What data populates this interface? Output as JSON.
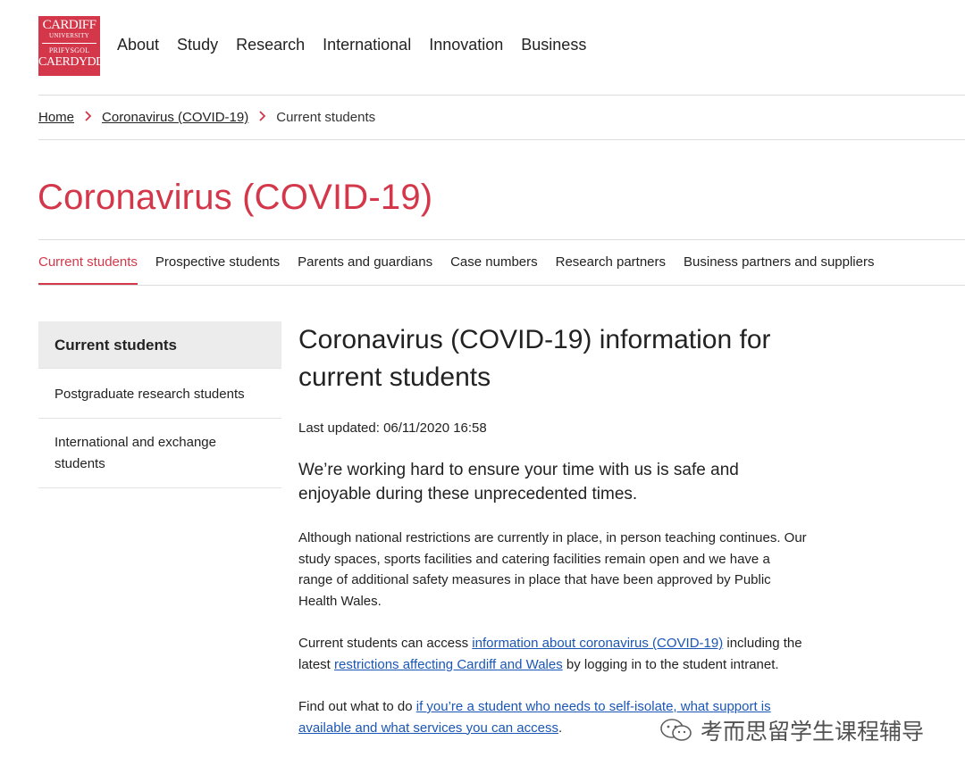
{
  "logo": {
    "line1": "CARDIFF",
    "line2": "UNIVERSITY",
    "line3": "PRIFYSGOL",
    "line4": "CAERDYDD",
    "color": "#d4374a"
  },
  "main_nav": [
    "About",
    "Study",
    "Research",
    "International",
    "Innovation",
    "Business"
  ],
  "breadcrumb": {
    "home": "Home",
    "section": "Coronavirus (COVID-19)",
    "current": "Current students",
    "separator_icon": "chevron-right-icon"
  },
  "page_title": "Coronavirus (COVID-19)",
  "tabs": [
    {
      "label": "Current students",
      "active": true
    },
    {
      "label": "Prospective students",
      "active": false
    },
    {
      "label": "Parents and guardians",
      "active": false
    },
    {
      "label": "Case numbers",
      "active": false
    },
    {
      "label": "Research partners",
      "active": false
    },
    {
      "label": "Business partners and suppliers",
      "active": false
    }
  ],
  "sidebar": {
    "items": [
      {
        "label": "Current students",
        "active": true
      },
      {
        "label": "Postgraduate research students",
        "active": false
      },
      {
        "label": "International and exchange students",
        "active": false
      }
    ]
  },
  "content": {
    "heading": "Coronavirus (COVID-19) information for current students",
    "last_updated": "Last updated: 06/11/2020 16:58",
    "lede": "We’re working hard to ensure your time with us is safe and enjoyable during these unprecedented times.",
    "para1": "Although national restrictions are currently in place, in person teaching continues. Our study spaces, sports facilities and catering facilities remain open and we have a range of additional safety measures in place that have been approved by Public Health Wales.",
    "para2": {
      "t1": "Current students can access ",
      "link1": "information about coronavirus (COVID-19)",
      "t2": " including the latest ",
      "link2": "restrictions affecting Cardiff and Wales",
      "t3": " by logging in to the student intranet."
    },
    "para3": {
      "t1": "Find out what to do ",
      "link1": "if you’re a student who needs to self-isolate, what support is available and what services you can access",
      "t2": "."
    }
  },
  "watermark": {
    "text": "考而思留学生课程辅导",
    "icon": "wechat-icon"
  },
  "colors": {
    "accent": "#d4374a",
    "link": "#1a56b6",
    "sidebar_active_bg": "#ececec"
  }
}
